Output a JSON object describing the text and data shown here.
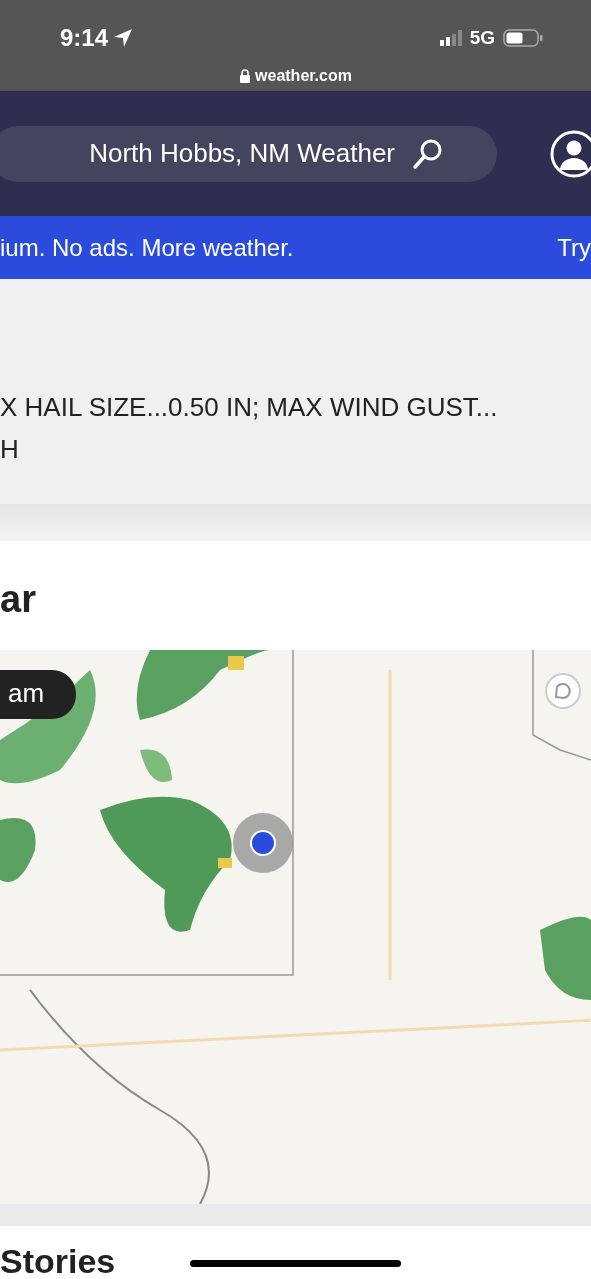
{
  "status_bar": {
    "time": "9:14",
    "network": "5G",
    "url": "weather.com"
  },
  "header": {
    "search": {
      "value": "North Hobbs, NM Weather"
    }
  },
  "promo_banner": {
    "text": "ium. No ads. More weather.",
    "action": "Try"
  },
  "alert": {
    "lines": [
      "X HAIL SIZE...0.50 IN; MAX WIND GUST...",
      "H"
    ]
  },
  "radar_card": {
    "title": "ar",
    "map": {
      "kind": "picture",
      "time_label": "am"
    }
  },
  "next_section": {
    "title": "Stories"
  }
}
